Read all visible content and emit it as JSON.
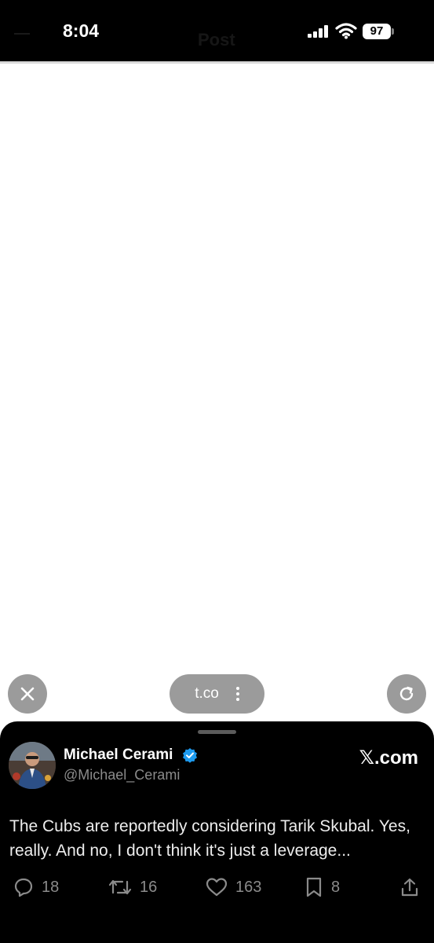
{
  "status_bar": {
    "time": "8:04",
    "battery": "97",
    "behind_title": "Post"
  },
  "browser": {
    "url_label": "t.co"
  },
  "post": {
    "author_name": "Michael Cerami",
    "author_handle": "@Michael_Cerami",
    "source_label": "𝕏.com",
    "text": "The Cubs are reportedly considering Tarik Skubal. Yes, really. And no, I don't think it's just a leverage...",
    "counts": {
      "replies": "18",
      "reposts": "16",
      "likes": "163",
      "bookmarks": "8"
    }
  },
  "colors": {
    "sheet_bg": "#000000",
    "muted": "#8b8b8b",
    "verified": "#1d9bf0",
    "fab_bg": "#9b9b9b"
  }
}
